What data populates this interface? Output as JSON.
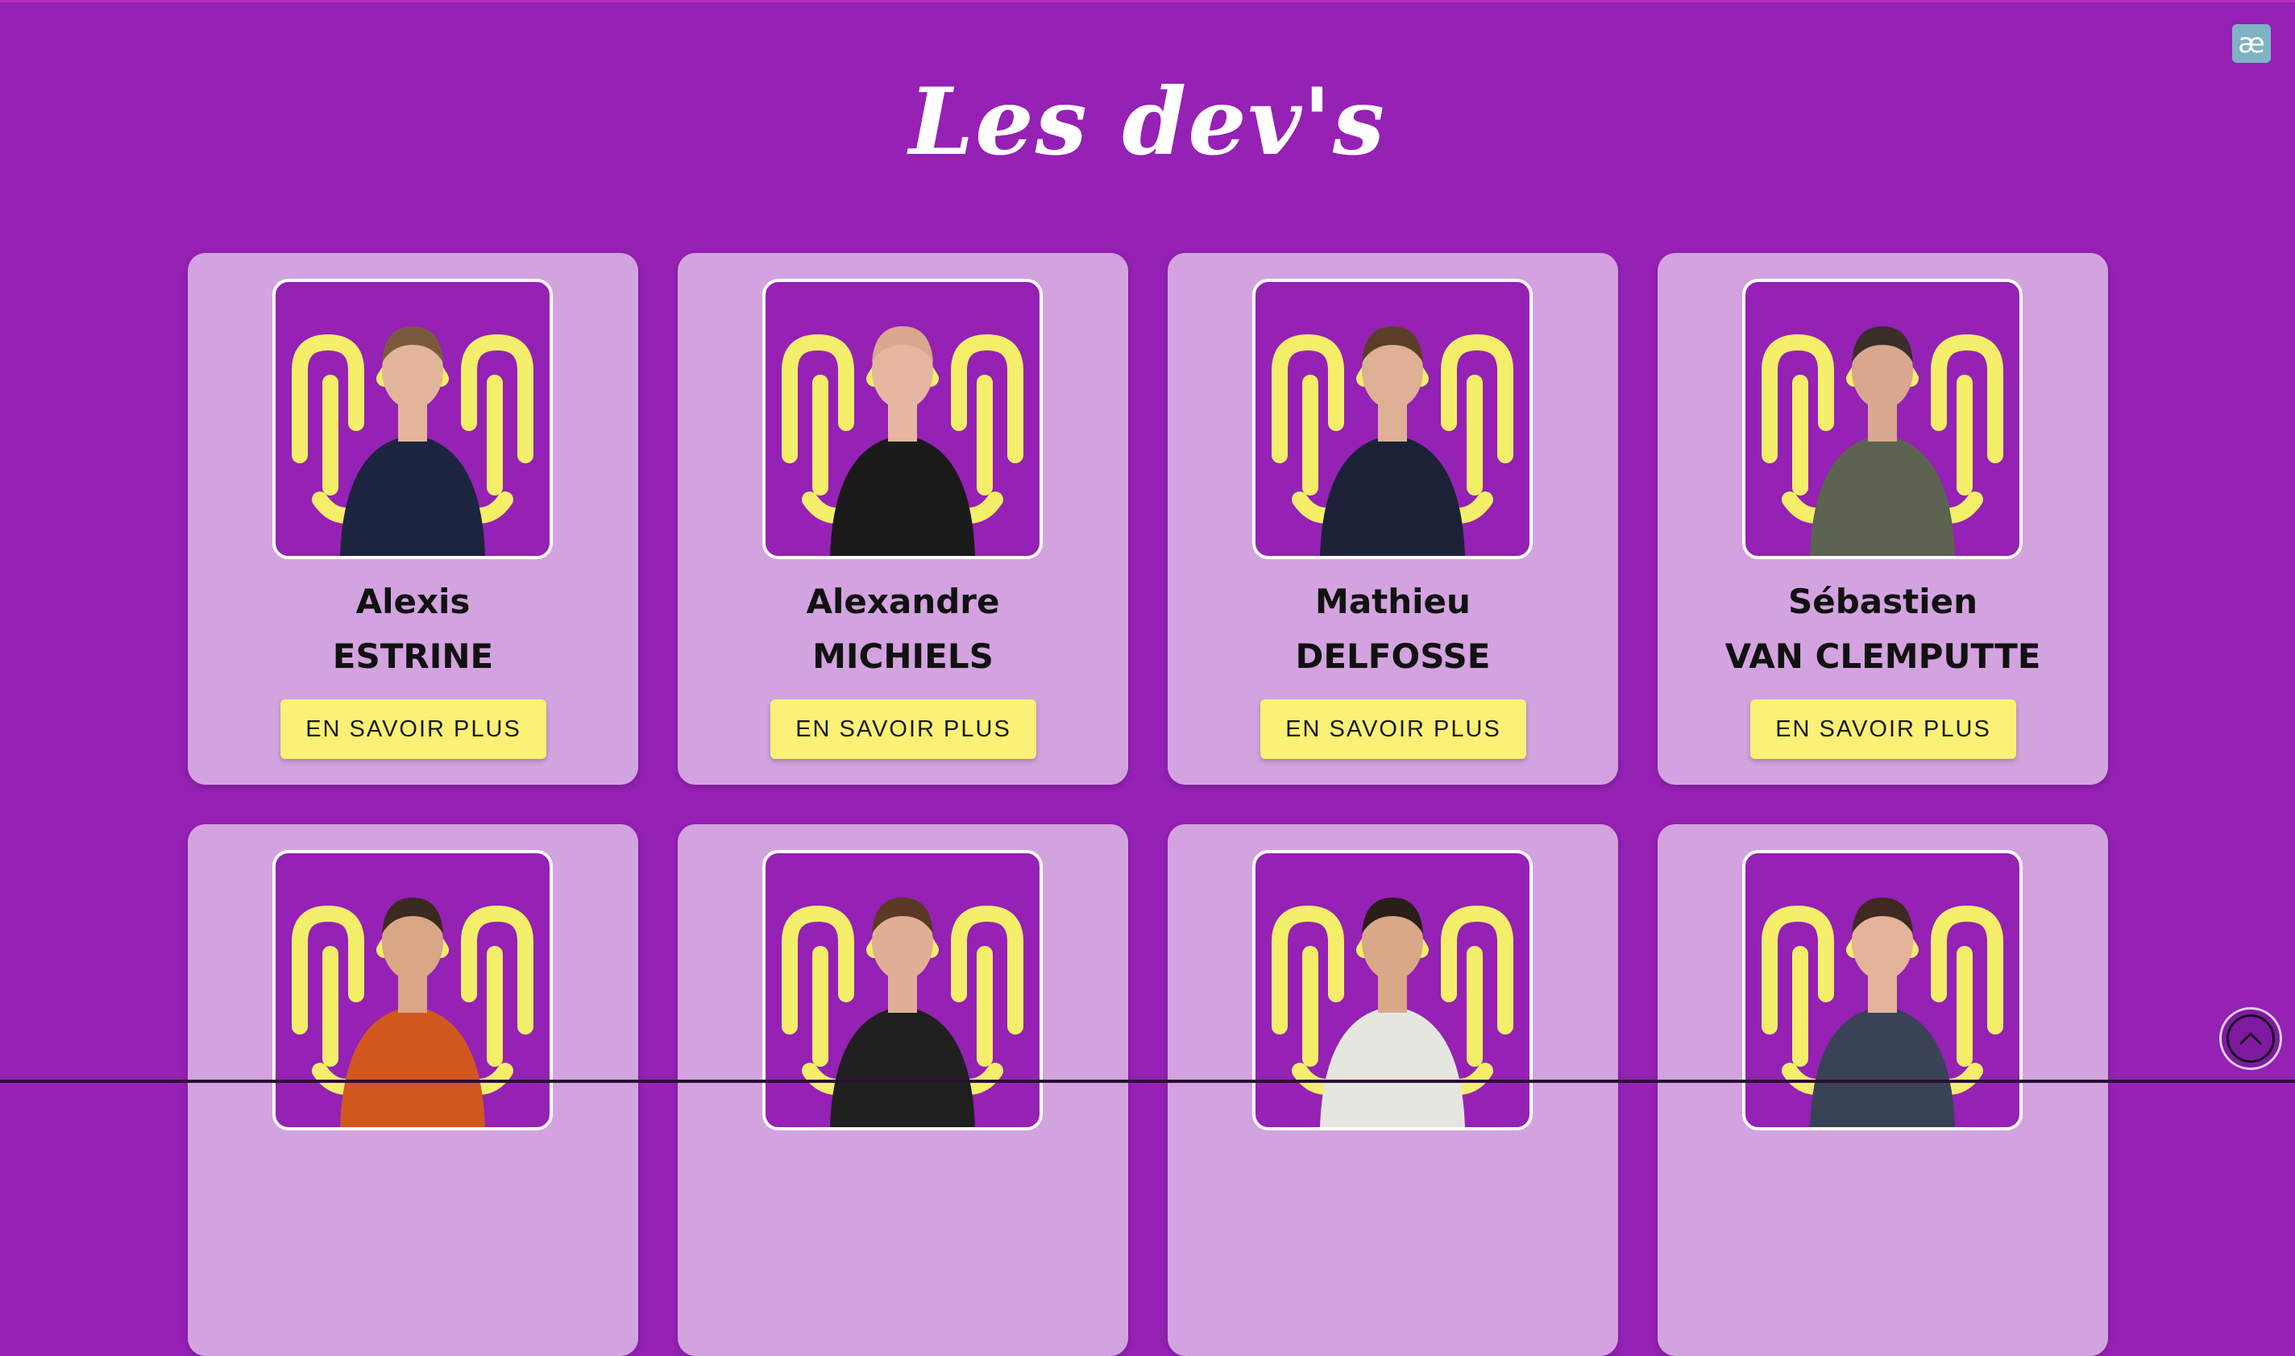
{
  "header": {
    "title": "Les dev's",
    "logo_text": "æ"
  },
  "theme": {
    "background": "#9521b5",
    "card": "#d3a3e0",
    "button": "#fbf176",
    "fingerprint": "#f5ee6a"
  },
  "developers": [
    {
      "first_name": "Alexis",
      "last_name": "ESTRINE",
      "button_label": "EN SAVOIR PLUS",
      "shirt": "#1c2440",
      "skin": "#e2b59a",
      "hair": "#7a5a3e"
    },
    {
      "first_name": "Alexandre",
      "last_name": "MICHIELS",
      "button_label": "EN SAVOIR PLUS",
      "shirt": "#1a1a1a",
      "skin": "#e5b7a0",
      "hair": "#d9a88e"
    },
    {
      "first_name": "Mathieu",
      "last_name": "DELFOSSE",
      "button_label": "EN SAVOIR PLUS",
      "shirt": "#1b2238",
      "skin": "#deb096",
      "hair": "#5a3e2a"
    },
    {
      "first_name": "Sébastien",
      "last_name": "VAN CLEMPUTTE",
      "button_label": "EN SAVOIR PLUS",
      "shirt": "#5c6350",
      "skin": "#d8a78e",
      "hair": "#3a2e28"
    },
    {
      "first_name": "",
      "last_name": "",
      "button_label": "",
      "shirt": "#d2571f",
      "skin": "#d9a686",
      "hair": "#3a2a20"
    },
    {
      "first_name": "",
      "last_name": "",
      "button_label": "",
      "shirt": "#202020",
      "skin": "#e0ae94",
      "hair": "#5a3a24"
    },
    {
      "first_name": "",
      "last_name": "",
      "button_label": "",
      "shirt": "#e6e6e0",
      "skin": "#d8a888",
      "hair": "#2a1e18"
    },
    {
      "first_name": "",
      "last_name": "",
      "button_label": "",
      "shirt": "#3a4258",
      "skin": "#e3b39a",
      "hair": "#3e2a20"
    }
  ],
  "scroll_top": {
    "icon": "chevron-up-icon"
  }
}
